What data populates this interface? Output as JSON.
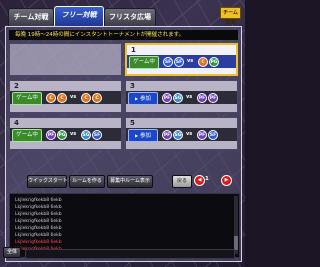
{
  "tabs": [
    {
      "label": "チーム対戦"
    },
    {
      "label": "フリー対戦"
    },
    {
      "label": "フリスタ広場"
    }
  ],
  "badge": "チーム対戦",
  "notice": "毎晩 19時～24時の間にインスタントトーナメントが開催されます。",
  "rooms": [
    {
      "num": "",
      "status": "",
      "left": [],
      "right": []
    },
    {
      "num": "1",
      "status": "ゲーム中",
      "left": [
        "SF",
        "SF"
      ],
      "right": [
        "C",
        "PG"
      ]
    },
    {
      "num": "2",
      "status": "ゲーム中",
      "left": [
        "C",
        "C"
      ],
      "right": [
        "C",
        "C"
      ]
    },
    {
      "num": "3",
      "status": "参加",
      "left": [
        "PF",
        "SG"
      ],
      "right": [
        "PF",
        "PF"
      ]
    },
    {
      "num": "4",
      "status": "ゲーム中",
      "left": [
        "PF",
        "PG"
      ],
      "right": [
        "SG",
        "SF"
      ]
    },
    {
      "num": "5",
      "status": "参加",
      "left": [
        "PF",
        "SG"
      ],
      "right": [
        "PF",
        "SF"
      ]
    }
  ],
  "vs": "vs",
  "buttons": {
    "quick_start": "ウイックスタート",
    "create_room": "ルームを作る",
    "recruit_rooms": "募集中ルーム表示",
    "back": "戻る"
  },
  "pager": {
    "prev": "◀",
    "label": "1",
    "next": "▶"
  },
  "chat": [
    {
      "text": "Lkjlekrigfkekb8 6ekb",
      "red": false
    },
    {
      "text": "Lkjlekrigfkekb8 6ekb",
      "red": false
    },
    {
      "text": "Lkjlekrigfkekb8 6ekb",
      "red": false
    },
    {
      "text": "Lkjlekrigfkekb8 6ekb",
      "red": false
    },
    {
      "text": "Lkjlekrigfkekb8 6ekb",
      "red": false
    },
    {
      "text": "Lkjlekrigfkekb8 6ekb",
      "red": false
    },
    {
      "text": "Lkjlekrigfkekb8 6ekb",
      "red": true
    },
    {
      "text": "Lkjlekrigfkekb8 6ekb",
      "red": true
    }
  ],
  "footer": {
    "all_label": "全体"
  }
}
